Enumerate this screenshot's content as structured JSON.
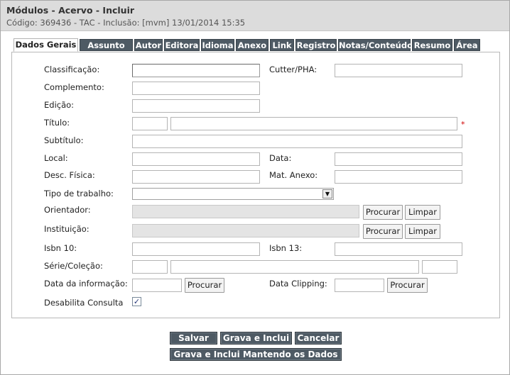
{
  "header": {
    "title": "Módulos - Acervo - Incluir",
    "subtitle": "Código: 369436 - TAC - Inclusão: [mvm] 13/01/2014 15:35"
  },
  "tabs": [
    {
      "label": "Dados Gerais",
      "active": true
    },
    {
      "label": "Assunto"
    },
    {
      "label": "Autor"
    },
    {
      "label": "Editora"
    },
    {
      "label": "Idioma"
    },
    {
      "label": "Anexo"
    },
    {
      "label": "Link"
    },
    {
      "label": "Registro"
    },
    {
      "label": "Notas/Conteúdo"
    },
    {
      "label": "Resumo"
    },
    {
      "label": "Área"
    }
  ],
  "form": {
    "classificacao": "Classificação:",
    "cutter": "Cutter/PHA:",
    "complemento": "Complemento:",
    "edicao": "Edição:",
    "titulo": "Título:",
    "required_mark": "*",
    "subtitulo": "Subtítulo:",
    "local": "Local:",
    "data": "Data:",
    "desc_fisica": "Desc. Física:",
    "mat_anexo": "Mat. Anexo:",
    "tipo_trabalho": "Tipo de trabalho:",
    "orientador": "Orientador:",
    "instituicao": "Instituição:",
    "isbn10": "Isbn 10:",
    "isbn13": "Isbn 13:",
    "serie": "Série/Coleção:",
    "data_informacao": "Data da informação:",
    "data_clipping": "Data Clipping:",
    "desabilita": "Desabilita Consulta",
    "desabilita_checked": true,
    "procurar": "Procurar",
    "limpar": "Limpar",
    "checkmark": "✓",
    "dropdown_arrow": "▼"
  },
  "actions": {
    "salvar": "Salvar",
    "grava_inclui": "Grava e Inclui",
    "cancelar": "Cancelar",
    "grava_mantendo": "Grava e Inclui Mantendo os Dados"
  },
  "colors": {
    "tab_bg": "#4e5a64",
    "header_bg": "#dcdcdc",
    "required": "#d00000"
  },
  "icons": {
    "dropdown": "chevron-down-icon",
    "checkbox": "checkmark-icon"
  }
}
